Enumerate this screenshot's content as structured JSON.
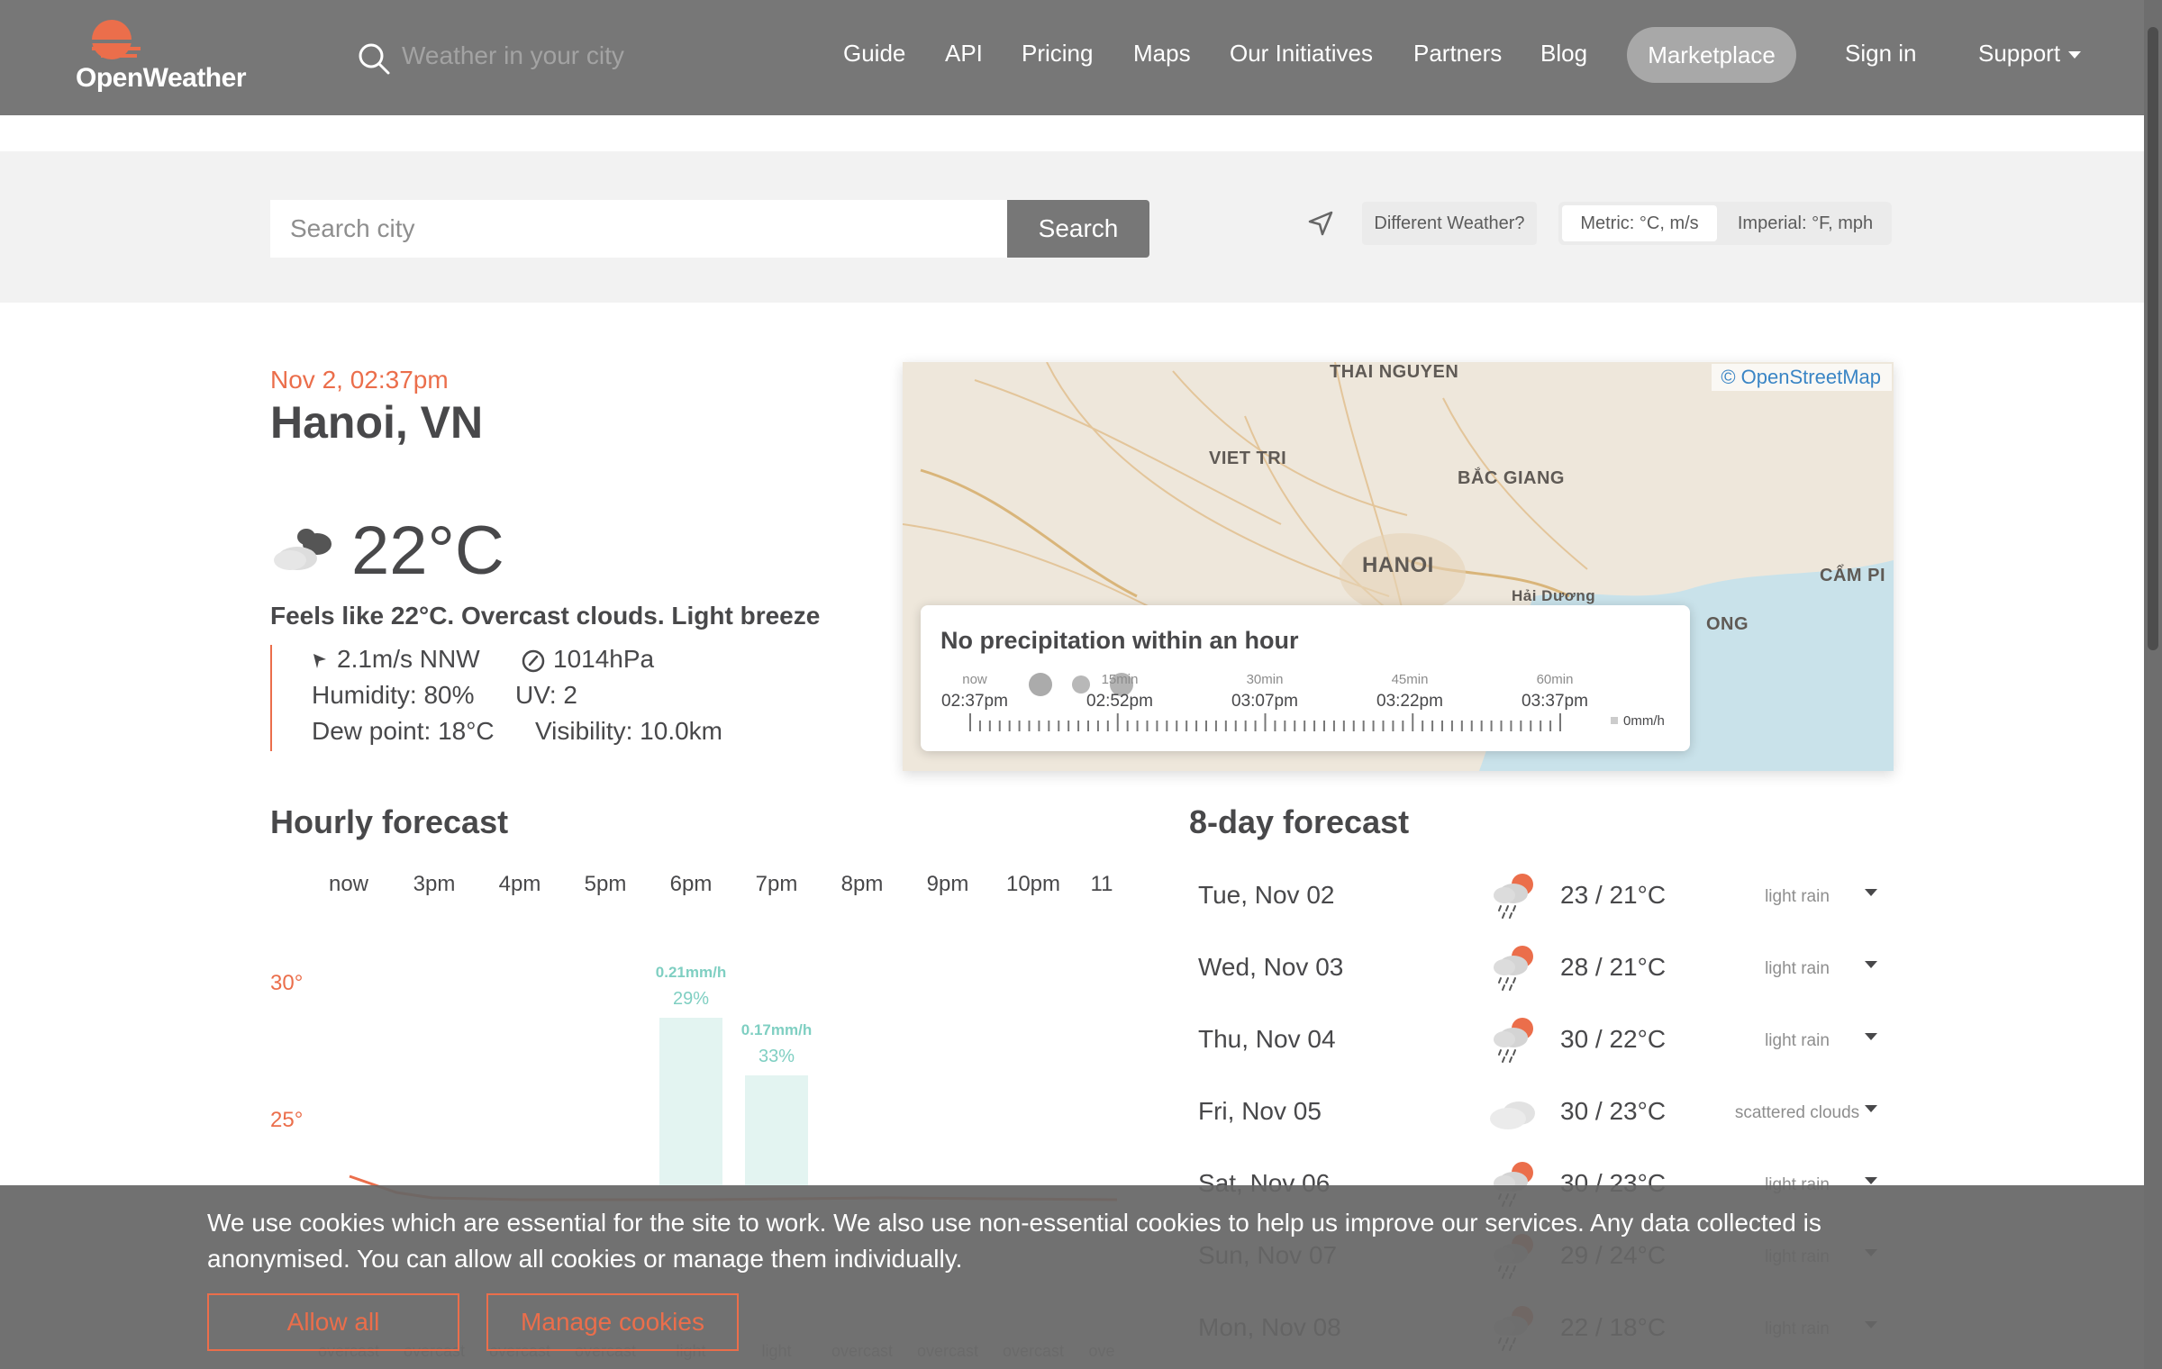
{
  "header": {
    "logo_text": "OpenWeather",
    "search_placeholder": "Weather in your city",
    "nav": [
      "Guide",
      "API",
      "Pricing",
      "Maps",
      "Our Initiatives",
      "Partners",
      "Blog"
    ],
    "marketplace": "Marketplace",
    "sign_in": "Sign in",
    "support": "Support"
  },
  "search": {
    "placeholder": "Search city",
    "button": "Search",
    "different_weather": "Different Weather?",
    "metric": "Metric: °C, m/s",
    "imperial": "Imperial: °F, mph"
  },
  "current": {
    "datetime": "Nov 2, 02:37pm",
    "city": "Hanoi, VN",
    "temp": "22°C",
    "summary": "Feels like 22°C. Overcast clouds. Light breeze",
    "wind": "2.1m/s NNW",
    "pressure": "1014hPa",
    "humidity": "Humidity: 80%",
    "uv": "UV: 2",
    "dew_point": "Dew point: 18°C",
    "visibility": "Visibility: 10.0km"
  },
  "map": {
    "attribution": "© OpenStreetMap",
    "labels": [
      "THAI NGUYEN",
      "VIET TRI",
      "BẮC GIANG",
      "HANOI",
      "Hải Dương",
      "CẨM PI",
      "ONG"
    ],
    "precip_title": "No precipitation within an hour",
    "timeline": [
      {
        "small": "now",
        "time": "02:37pm"
      },
      {
        "small": "15min",
        "time": "02:52pm"
      },
      {
        "small": "30min",
        "time": "03:07pm"
      },
      {
        "small": "45min",
        "time": "03:22pm"
      },
      {
        "small": "60min",
        "time": "03:37pm"
      }
    ],
    "legend": "0mm/h"
  },
  "hourly": {
    "title": "Hourly forecast",
    "hours": [
      "now",
      "3pm",
      "4pm",
      "5pm",
      "6pm",
      "7pm",
      "8pm",
      "9pm",
      "10pm",
      "11"
    ],
    "y_labels": [
      "30°",
      "25°"
    ],
    "rain": [
      {
        "hour_index": 4,
        "mm": "0.21mm/h",
        "pct": "29%",
        "probability": 0.29
      },
      {
        "hour_index": 5,
        "mm": "0.17mm/h",
        "pct": "33%",
        "probability": 0.33
      }
    ],
    "descriptions": [
      "overcast",
      "overcast",
      "overcast",
      "overcast",
      "light",
      "light",
      "overcast",
      "overcast",
      "overcast",
      "ove"
    ]
  },
  "daily": {
    "title": "8-day forecast",
    "days": [
      {
        "date": "Tue, Nov 02",
        "temp": "23 / 21°C",
        "desc": "light rain",
        "icon": "rain-icon"
      },
      {
        "date": "Wed, Nov 03",
        "temp": "28 / 21°C",
        "desc": "light rain",
        "icon": "rain-icon"
      },
      {
        "date": "Thu, Nov 04",
        "temp": "30 / 22°C",
        "desc": "light rain",
        "icon": "rain-icon"
      },
      {
        "date": "Fri, Nov 05",
        "temp": "30 / 23°C",
        "desc": "scattered clouds",
        "icon": "cloud-icon"
      },
      {
        "date": "Sat, Nov 06",
        "temp": "30 / 23°C",
        "desc": "light rain",
        "icon": "rain-icon"
      },
      {
        "date": "Sun, Nov 07",
        "temp": "29 / 24°C",
        "desc": "light rain",
        "icon": "rain-icon"
      },
      {
        "date": "Mon, Nov 08",
        "temp": "22 / 18°C",
        "desc": "light rain",
        "icon": "rain-icon"
      }
    ]
  },
  "cookie": {
    "text": "We use cookies which are essential for the site to work. We also use non-essential cookies to help us improve our services. Any data collected is anonymised. You can allow all cookies or manage them individually.",
    "allow": "Allow all",
    "manage": "Manage cookies"
  },
  "colors": {
    "accent": "#eb6e4b",
    "header_bg": "#777777",
    "rain_bar": "#e3f4f1",
    "rain_text": "#7fcfc2"
  }
}
